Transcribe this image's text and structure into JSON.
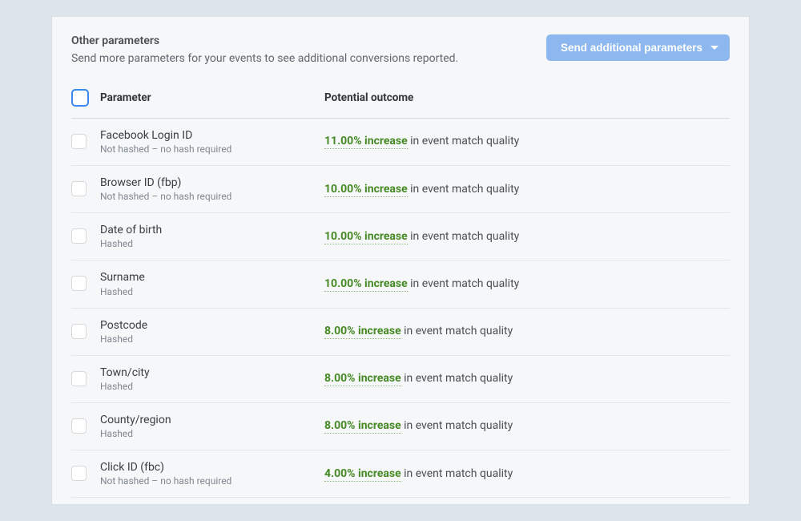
{
  "header": {
    "title": "Other parameters",
    "subtitle": "Send more parameters for your events to see additional conversions reported.",
    "button_label": "Send additional parameters"
  },
  "table": {
    "header_parameter": "Parameter",
    "header_outcome": "Potential outcome",
    "outcome_suffix": " in event match quality",
    "rows": [
      {
        "name": "Facebook Login ID",
        "sub": "Not hashed – no hash required",
        "increase": "11.00% increase"
      },
      {
        "name": "Browser ID (fbp)",
        "sub": "Not hashed – no hash required",
        "increase": "10.00% increase"
      },
      {
        "name": "Date of birth",
        "sub": "Hashed",
        "increase": "10.00% increase"
      },
      {
        "name": "Surname",
        "sub": "Hashed",
        "increase": "10.00% increase"
      },
      {
        "name": "Postcode",
        "sub": "Hashed",
        "increase": "8.00% increase"
      },
      {
        "name": "Town/city",
        "sub": "Hashed",
        "increase": "8.00% increase"
      },
      {
        "name": "County/region",
        "sub": "Hashed",
        "increase": "8.00% increase"
      },
      {
        "name": "Click ID (fbc)",
        "sub": "Not hashed – no hash required",
        "increase": "4.00% increase"
      }
    ]
  }
}
